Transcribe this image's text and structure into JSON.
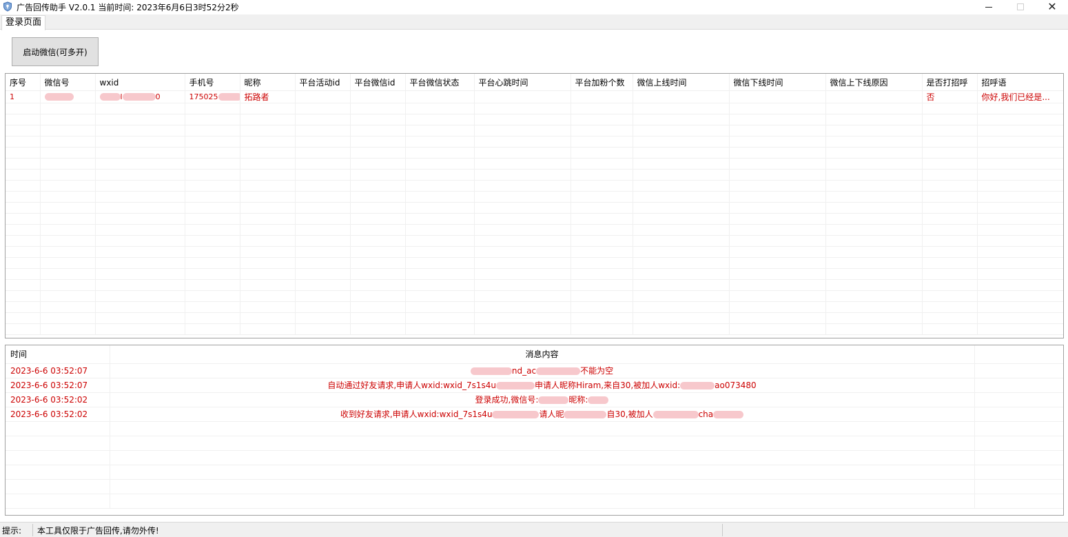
{
  "window": {
    "title": "广告回传助手 V2.0.1 当前时间: 2023年6月6日3时52分2秒"
  },
  "tabs": [
    {
      "label": "登录页面"
    }
  ],
  "toolbar": {
    "launch_label": "启动微信(可多开)"
  },
  "accounts": {
    "columns": [
      "序号",
      "微信号",
      "wxid",
      "手机号",
      "昵称",
      "平台活动id",
      "平台微信id",
      "平台微信状态",
      "平台心跳时间",
      "平台加粉个数",
      "微信上线时间",
      "微信下线时间",
      "微信上下线原因",
      "是否打招呼",
      "招呼语"
    ],
    "rows": [
      {
        "index": "1",
        "wechat_no": "",
        "wxid_tail": "l",
        "wxid_end": "0",
        "phone": "175025",
        "nickname": "拓路者",
        "greet_flag": "否",
        "greeting": "你好,我们已经是..."
      }
    ]
  },
  "log": {
    "columns": [
      "时间",
      "消息内容"
    ],
    "rows": [
      {
        "time": "2023-6-6 03:52:07",
        "parts": [
          "",
          "nd_ac",
          "",
          "不能为空"
        ]
      },
      {
        "time": "2023-6-6 03:52:07",
        "parts": [
          "自动通过好友请求,申请人wxid:wxid_7s1s4u",
          "",
          "申请人昵称Hiram,来自30,被加人wxid:",
          "",
          "ao073480"
        ]
      },
      {
        "time": "2023-6-6 03:52:02",
        "parts": [
          "登录成功,微信号:",
          "",
          "昵称:",
          ""
        ]
      },
      {
        "time": "2023-6-6 03:52:02",
        "parts": [
          "收到好友请求,申请人wxid:wxid_7s1s4u",
          "",
          "请人昵",
          "",
          "自30,被加人",
          "",
          "cha",
          ""
        ]
      }
    ]
  },
  "statusbar": {
    "label": "提示:",
    "message": "本工具仅限于广告回传,请勿外传!"
  },
  "colors": {
    "data_text": "#cc0000",
    "redaction": "#f7c8cc"
  },
  "icons": {
    "app": "shield-icon"
  }
}
